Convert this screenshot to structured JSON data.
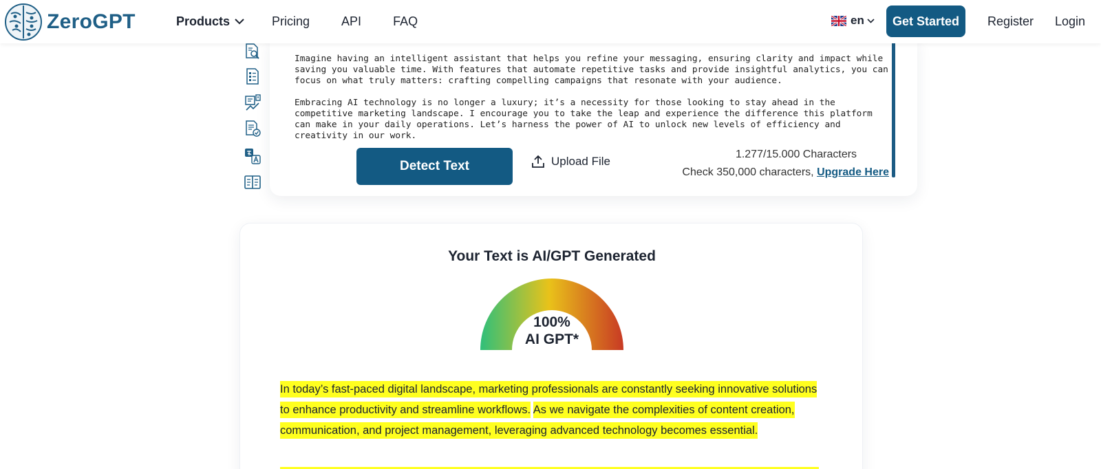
{
  "header": {
    "logo_text": "ZeroGPT",
    "nav": [
      {
        "label": "Products",
        "has_dropdown": true
      },
      {
        "label": "Pricing"
      },
      {
        "label": "API"
      },
      {
        "label": "FAQ"
      }
    ],
    "language": {
      "code": "en",
      "flag_icon": "uk-flag-icon"
    },
    "get_started": "Get Started",
    "register": "Register",
    "login": "Login"
  },
  "rail_icons": [
    "document-search-icon",
    "checklist-document-icon",
    "ai-detector-icon",
    "document-check-icon",
    "translate-icon",
    "compare-icon"
  ],
  "editor": {
    "paragraphs": [
      "Imagine having an intelligent assistant that helps you refine your messaging, ensuring clarity and impact while saving you valuable time. With features that automate repetitive tasks and provide insightful analytics, you can focus on what truly matters: crafting compelling campaigns that resonate with your audience.",
      "Embracing AI technology is no longer a luxury; it’s a necessity for those looking to stay ahead in the competitive marketing landscape. I encourage you to take the leap and experience the difference this platform can make in your daily operations. Let’s harness the power of AI to unlock new levels of efficiency and creativity in our work."
    ]
  },
  "actions": {
    "detect_label": "Detect Text",
    "upload_label": "Upload File",
    "char_count": "1.277/15.000 Characters",
    "upgrade_prefix": "Check 350,000 characters, ",
    "upgrade_link": "Upgrade Here"
  },
  "result": {
    "title": "Your Text is AI/GPT Generated",
    "percent_text": "100%",
    "percent_value": 100,
    "label": "AI GPT*",
    "gauge_colors": [
      "#2fbf7a",
      "#e9c21a",
      "#c83a24"
    ],
    "highlight_color": "#ffff1f",
    "sentences": [
      "In today’s fast-paced digital landscape, marketing professionals are constantly seeking innovative solutions to enhance productivity and streamline workflows.",
      "As we navigate the complexities of content creation, communication, and project management, leveraging advanced technology becomes essential."
    ]
  },
  "colors": {
    "brand": "#135a83",
    "logo": "#1f5f86"
  }
}
